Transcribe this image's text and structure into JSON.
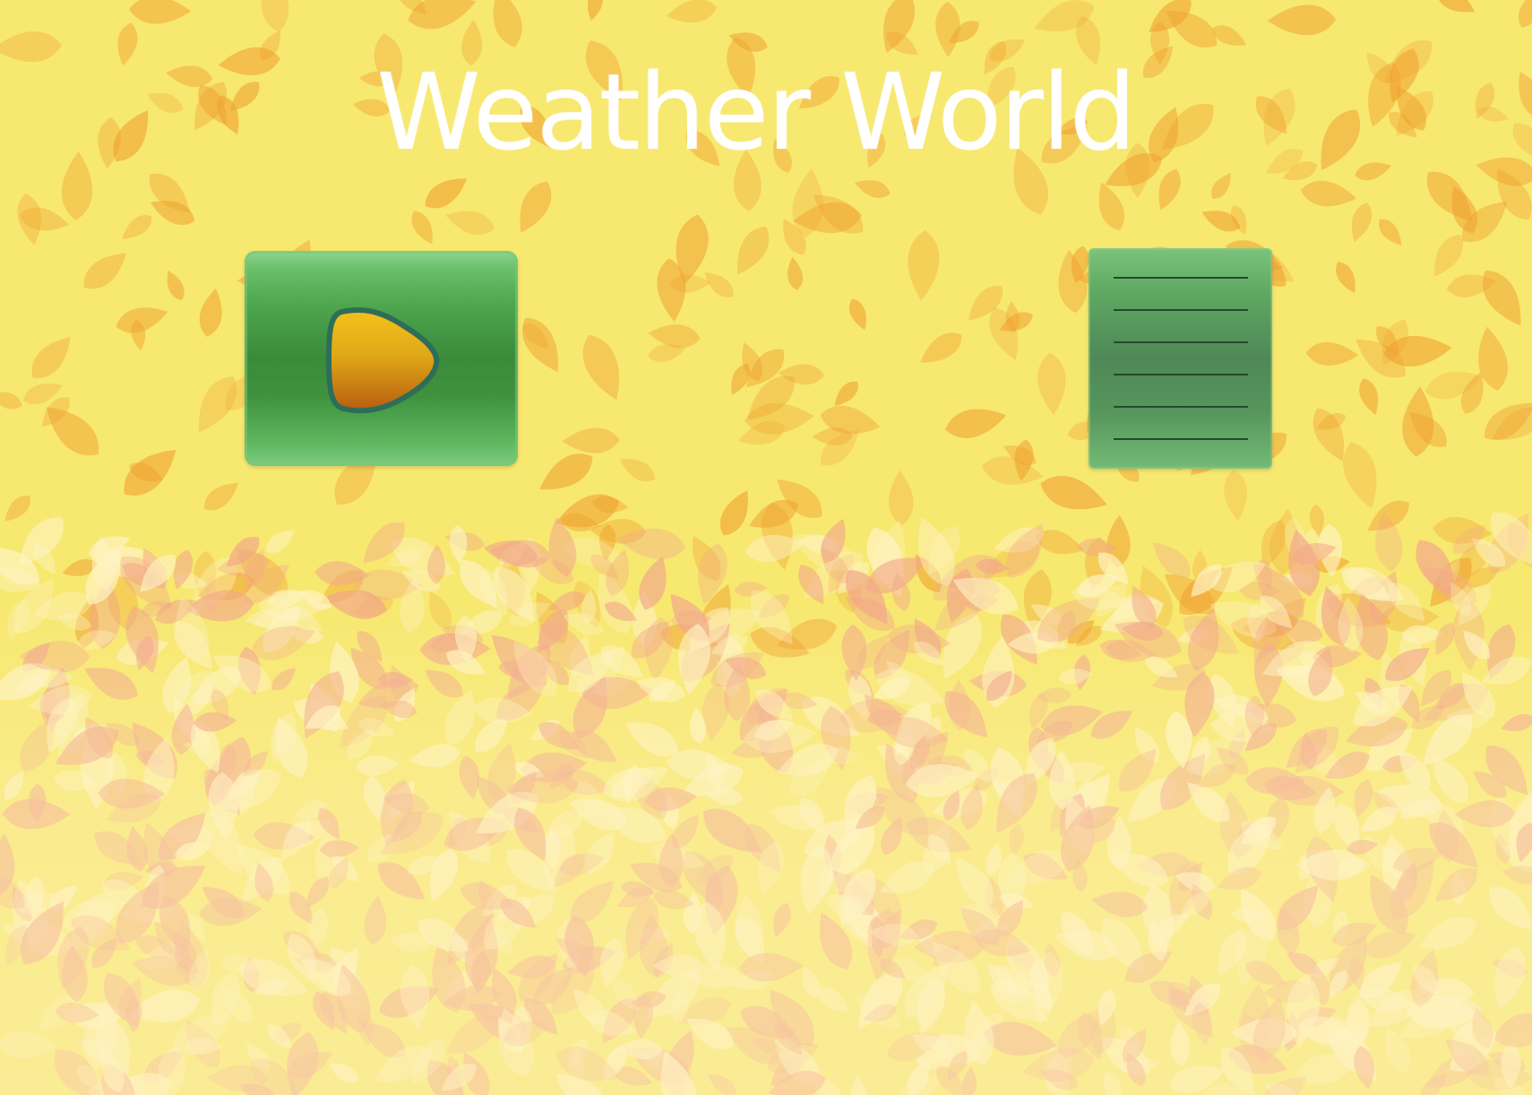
{
  "title": "Weather World",
  "colors": {
    "background": "#f7e870",
    "leaf_orange": "#f0a030",
    "leaf_pink": "#f2a78a",
    "leaf_cream": "#fff3c4",
    "button_green": "#3a8a3a",
    "play_icon_gold": "#e0a818",
    "play_icon_brown": "#b85d10",
    "title_text": "#ffffff"
  },
  "buttons": {
    "play": {
      "icon": "play-icon"
    },
    "menu": {
      "icon": "list-icon"
    }
  }
}
